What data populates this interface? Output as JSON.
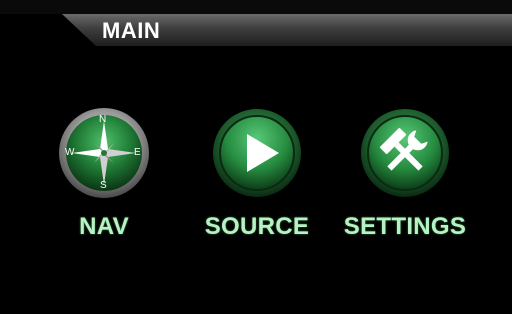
{
  "header": {
    "title": "MAIN"
  },
  "menu": {
    "items": [
      {
        "label": "NAV",
        "icon": "compass-icon"
      },
      {
        "label": "SOURCE",
        "icon": "play-icon"
      },
      {
        "label": "SETTINGS",
        "icon": "tools-icon"
      }
    ]
  },
  "compass": {
    "north": "N",
    "south": "S",
    "east": "E",
    "west": "W"
  },
  "colors": {
    "accent_green": "#2f9a4a",
    "label_green": "#b6f2c2",
    "background": "#000000"
  }
}
